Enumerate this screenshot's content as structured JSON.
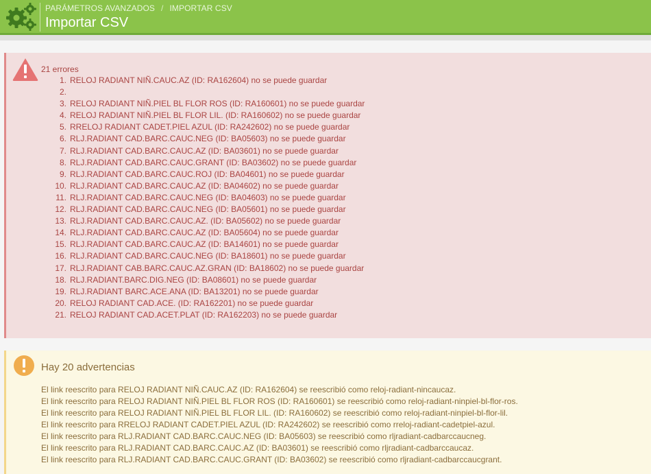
{
  "header": {
    "breadcrumb": [
      "PARÁMETROS AVANZADOS",
      "IMPORTAR CSV"
    ],
    "breadcrumb_separator": "/",
    "title": "Importar CSV",
    "icon": "gears-icon",
    "color": "#8bc34a"
  },
  "errors": {
    "count_label": "21 errores",
    "icon": "warning-triangle-icon",
    "background": "#f2dede",
    "text_color": "#a94442",
    "items": [
      {
        "n": "1.",
        "text": "RELOJ RADIANT NIÑ.CAUC.AZ (ID: RA162604) no se puede guardar"
      },
      {
        "n": "2.",
        "text": ""
      },
      {
        "n": "3.",
        "text": "RELOJ RADIANT NIÑ.PIEL BL FLOR ROS (ID: RA160601) no se puede guardar"
      },
      {
        "n": "4.",
        "text": "RELOJ RADIANT NIÑ.PIEL BL FLOR LIL. (ID: RA160602) no se puede guardar"
      },
      {
        "n": "5.",
        "text": "RRELOJ RADIANT CADET.PIEL AZUL (ID: RA242602) no se puede guardar"
      },
      {
        "n": "6.",
        "text": "RLJ.RADIANT CAD.BARC.CAUC.NEG (ID: BA05603) no se puede guardar"
      },
      {
        "n": "7.",
        "text": "RLJ.RADIANT CAD.BARC.CAUC.AZ (ID: BA03601) no se puede guardar"
      },
      {
        "n": "8.",
        "text": "RLJ.RADIANT CAD.BARC.CAUC.GRANT (ID: BA03602) no se puede guardar"
      },
      {
        "n": "9.",
        "text": "RLJ.RADIANT CAD.BARC.CAUC.ROJ (ID: BA04601) no se puede guardar"
      },
      {
        "n": "10.",
        "text": "RLJ.RADIANT CAD.BARC.CAUC.AZ (ID: BA04602) no se puede guardar"
      },
      {
        "n": "11.",
        "text": "RLJ.RADIANT CAD.BARC.CAUC.NEG (ID: BA04603) no se puede guardar"
      },
      {
        "n": "12.",
        "text": "RLJ.RADIANT CAD.BARC.CAUC.NEG (ID: BA05601) no se puede guardar"
      },
      {
        "n": "13.",
        "text": "RLJ.RADIANT CAD.BARC.CAUC.AZ. (ID: BA05602) no se puede guardar"
      },
      {
        "n": "14.",
        "text": "RLJ.RADIANT CAD.BARC.CAUC.AZ (ID: BA05604) no se puede guardar"
      },
      {
        "n": "15.",
        "text": "RLJ.RADIANT CAD.BARC.CAUC.AZ (ID: BA14601) no se puede guardar"
      },
      {
        "n": "16.",
        "text": "RLJ.RADIANT CAD.BARC.CAUC.NEG (ID: BA18601) no se puede guardar"
      },
      {
        "n": "17.",
        "text": "RLJ.RADIANT CAB.BARC.CAUC.AZ.GRAN (ID: BA18602) no se puede guardar"
      },
      {
        "n": "18.",
        "text": "RLJ.RADIANT.BARC.DIG.NEG (ID: BA08601) no se puede guardar"
      },
      {
        "n": "19.",
        "text": "RLJ.RADIANT BARC.ACE.ANA (ID: BA13201) no se puede guardar"
      },
      {
        "n": "20.",
        "text": "RELOJ RADIANT CAD.ACE. (ID: RA162201) no se puede guardar"
      },
      {
        "n": "21.",
        "text": "RELOJ RADIANT CAD.ACET.PLAT (ID: RA162203) no se puede guardar"
      }
    ]
  },
  "warnings": {
    "title": "Hay 20 advertencias",
    "icon": "exclamation-circle-icon",
    "background": "#fcf8e3",
    "text_color": "#8a6d3b",
    "items": [
      "El link reescrito para RELOJ RADIANT NIÑ.CAUC.AZ (ID: RA162604) se reescribió como reloj-radiant-nincaucaz.",
      "El link reescrito para RELOJ RADIANT NIÑ.PIEL BL FLOR ROS (ID: RA160601) se reescribió como reloj-radiant-ninpiel-bl-flor-ros.",
      "El link reescrito para RELOJ RADIANT NIÑ.PIEL BL FLOR LIL. (ID: RA160602) se reescribió como reloj-radiant-ninpiel-bl-flor-lil.",
      "El link reescrito para RRELOJ RADIANT CADET.PIEL AZUL (ID: RA242602) se reescribió como rreloj-radiant-cadetpiel-azul.",
      "El link reescrito para RLJ.RADIANT CAD.BARC.CAUC.NEG (ID: BA05603) se reescribió como rljradiant-cadbarccaucneg.",
      "El link reescrito para RLJ.RADIANT CAD.BARC.CAUC.AZ (ID: BA03601) se reescribió como rljradiant-cadbarccaucaz.",
      "El link reescrito para RLJ.RADIANT CAD.BARC.CAUC.GRANT (ID: BA03602) se reescribió como rljradiant-cadbarccaucgrant."
    ]
  }
}
